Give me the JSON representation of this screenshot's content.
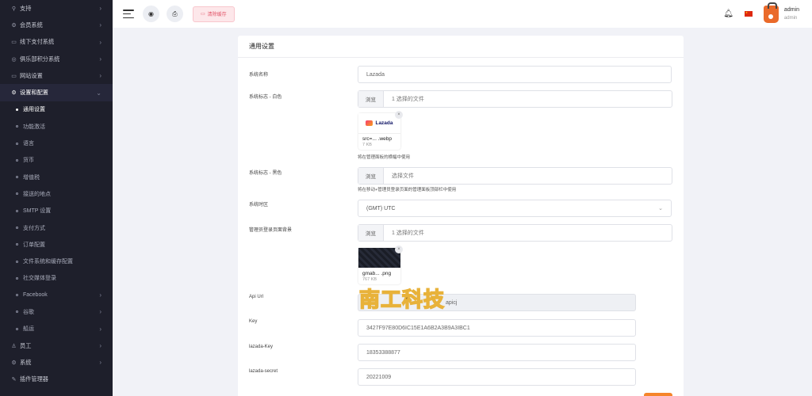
{
  "sidebar": {
    "top_items": [
      {
        "icon": "link-icon",
        "label": "支持"
      },
      {
        "icon": "member-icon",
        "label": "会员系统"
      },
      {
        "icon": "payment-icon",
        "label": "线下支付系统"
      },
      {
        "icon": "club-icon",
        "label": "俱乐部积分系统"
      },
      {
        "icon": "monitor-icon",
        "label": "网站设置"
      },
      {
        "icon": "settings-icon",
        "label": "设置和配置"
      }
    ],
    "sub_items": [
      {
        "label": "通用设置",
        "chevron": false
      },
      {
        "label": "功能激活",
        "chevron": false
      },
      {
        "label": "语言",
        "chevron": false
      },
      {
        "label": "货币",
        "chevron": false
      },
      {
        "label": "增值税",
        "chevron": false
      },
      {
        "label": "接送的地点",
        "chevron": false
      },
      {
        "label": "SMTP 设置",
        "chevron": false
      },
      {
        "label": "支付方式",
        "chevron": false
      },
      {
        "label": "订单配置",
        "chevron": false
      },
      {
        "label": "文件系统和缓存配置",
        "chevron": false
      },
      {
        "label": "社交媒体登录",
        "chevron": false
      },
      {
        "label": "Facebook",
        "chevron": true
      },
      {
        "label": "谷歌",
        "chevron": true
      },
      {
        "label": "船运",
        "chevron": true
      }
    ],
    "bottom_items": [
      {
        "icon": "staff-icon",
        "label": "员工"
      },
      {
        "icon": "system-icon",
        "label": "系统"
      },
      {
        "icon": "plugin-icon",
        "label": "插件管理器"
      }
    ]
  },
  "topbar": {
    "cache_button": "清除缓存",
    "username": "admin",
    "role": "admin"
  },
  "page": {
    "card_title": "通用设置",
    "labels": {
      "system_name": "系统名称",
      "logo_white": "系统标志 - 白色",
      "logo_black": "系统标志 - 黑色",
      "timezone": "系统时区",
      "admin_bg": "管理员登录页面背景",
      "api_url": "Api Url",
      "key": "Key",
      "lazada_key": "lazada-Key",
      "lazada_secret": "lazada-secret"
    },
    "values": {
      "system_name": "Lazada",
      "timezone": "(GMT) UTC",
      "api_url": "apicj",
      "key": "3427F97E80D6IC15E1A6B2A3B9A3IBC1",
      "lazada_key": "18353388877",
      "lazada_secret": "20221009"
    },
    "file_inputs": {
      "browse": "浏览",
      "logo_white_selected": "1 选择的文件",
      "logo_black_placeholder": "选择文件",
      "admin_bg_selected": "1 选择的文件"
    },
    "thumbs": {
      "logo_white": {
        "logo_text": "Lazada",
        "name": "src=... .webp",
        "size": "7 KB"
      },
      "admin_bg": {
        "name": "gmab... .png",
        "size": "767 KB"
      }
    },
    "hints": {
      "logo_white": "将在管理面板的横幅中使用",
      "logo_black": "将在移动+管理员登录页面的管理面板顶部栏中使用"
    }
  },
  "watermark": "南工科技"
}
